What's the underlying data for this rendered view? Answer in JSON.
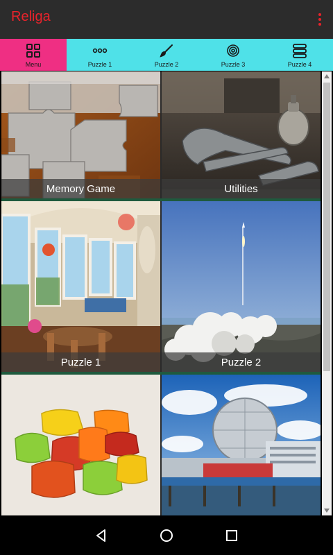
{
  "app": {
    "title": "Religa",
    "accent": "#e8232b"
  },
  "tabs": [
    {
      "label": "Menu",
      "icon": "grid-icon",
      "active": true
    },
    {
      "label": "Puzzle 1",
      "icon": "dots-icon",
      "active": false
    },
    {
      "label": "Puzzle 2",
      "icon": "brush-icon",
      "active": false
    },
    {
      "label": "Puzzle 3",
      "icon": "target-icon",
      "active": false
    },
    {
      "label": "Puzzle 4",
      "icon": "stack-icon",
      "active": false
    }
  ],
  "tiles": [
    {
      "caption": "Memory Game",
      "image": "puzzle-pieces-image"
    },
    {
      "caption": "Utilities",
      "image": "tools-image"
    },
    {
      "caption": "Puzzle 1",
      "image": "conservatory-room-image"
    },
    {
      "caption": "Puzzle 2",
      "image": "rocket-launch-image"
    },
    {
      "caption": "",
      "image": "jelly-candies-image"
    },
    {
      "caption": "",
      "image": "science-dome-image"
    }
  ],
  "colors": {
    "tabbar": "#4fe1e8",
    "active_tab": "#ef2f83",
    "appbar": "#2c2c2c"
  }
}
